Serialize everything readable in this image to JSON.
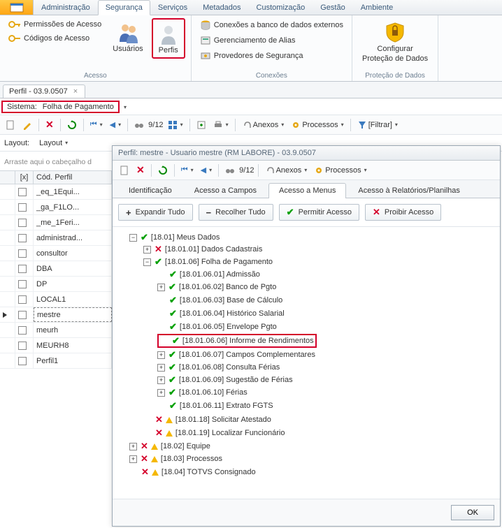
{
  "menu": {
    "tabs": [
      "Administração",
      "Segurança",
      "Serviços",
      "Metadados",
      "Customização",
      "Gestão",
      "Ambiente"
    ],
    "active_index": 1
  },
  "ribbon": {
    "acesso": {
      "label": "Acesso",
      "perm": "Permissões de Acesso",
      "cod": "Códigos de Acesso",
      "usuarios": "Usuários",
      "perfis": "Perfis"
    },
    "conexoes": {
      "label": "Conexões",
      "ext": "Conexões a banco de dados externos",
      "alias": "Gerenciamento de Alias",
      "prov": "Provedores de Segurança"
    },
    "protecao": {
      "label": "Proteção de Dados",
      "btn1": "Configurar",
      "btn2": "Proteção de Dados"
    }
  },
  "doc_tab": {
    "title": "Perfil - 03.9.0507"
  },
  "system": {
    "label": "Sistema:",
    "value": "Folha de Pagamento"
  },
  "toolbar": {
    "nav": "9/12",
    "anexos": "Anexos",
    "processos": "Processos",
    "filtrar": "[Filtrar]"
  },
  "layout_row": {
    "label": "Layout:",
    "dropdown": "Layout"
  },
  "grid": {
    "hint": "Arraste aqui o cabeçalho d",
    "h1": "[x]",
    "h2": "Cód. Perfil",
    "rows": [
      "_eq_1Equi...",
      "_ga_F1LO...",
      "_me_1Feri...",
      "administrad...",
      "consultor",
      "DBA",
      "DP",
      "LOCAL1",
      "mestre",
      "meurh",
      "MEURH8",
      "Perfil1"
    ],
    "selected_index": 8
  },
  "popup": {
    "title": "Perfil: mestre - Usuario mestre (RM LABORE) - 03.9.0507",
    "toolbar_nav": "9/12",
    "tabs": [
      "Identificação",
      "Acesso a Campos",
      "Acesso a Menus",
      "Acesso à Relatórios/Planilhas"
    ],
    "active_tab": 2,
    "actions": {
      "expand": "Expandir Tudo",
      "collapse": "Recolher Tudo",
      "permit": "Permitir Acesso",
      "deny": "Proibir Acesso"
    },
    "ok": "OK",
    "tree": {
      "n1": "[18.01] Meus Dados",
      "n1_1": "[18.01.01] Dados Cadastrais",
      "n1_6": "[18.01.06] Folha de Pagamento",
      "n1_6_1": "[18.01.06.01] Admissão",
      "n1_6_2": "[18.01.06.02] Banco de Pgto",
      "n1_6_3": "[18.01.06.03] Base de Cálculo",
      "n1_6_4": "[18.01.06.04] Histórico Salarial",
      "n1_6_5": "[18.01.06.05] Envelope Pgto",
      "n1_6_6": "[18.01.06.06] Informe de Rendimentos",
      "n1_6_7": "[18.01.06.07] Campos Complementares",
      "n1_6_8": "[18.01.06.08] Consulta Férias",
      "n1_6_9": "[18.01.06.09] Sugestão de Férias",
      "n1_6_10": "[18.01.06.10] Férias",
      "n1_6_11": "[18.01.06.11] Extrato FGTS",
      "n1_18": "[18.01.18] Solicitar Atestado",
      "n1_19": "[18.01.19] Localizar Funcionário",
      "n2": "[18.02] Equipe",
      "n3": "[18.03] Processos",
      "n4": "[18.04] TOTVS Consignado"
    }
  }
}
